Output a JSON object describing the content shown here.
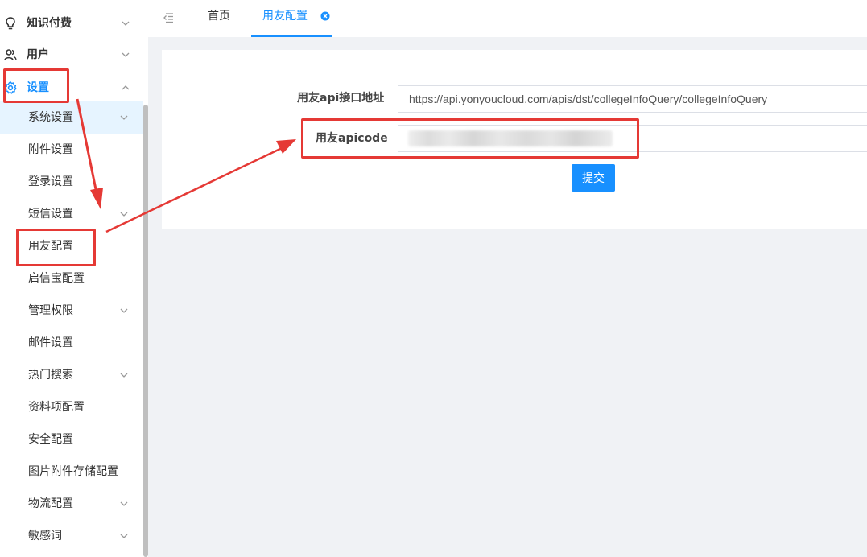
{
  "sidebar": {
    "top_items": [
      {
        "label": "知识付费",
        "icon": "lightbulb-icon"
      },
      {
        "label": "用户",
        "icon": "users-icon"
      },
      {
        "label": "设置",
        "icon": "gear-icon",
        "active": true
      }
    ],
    "sub_items": [
      {
        "label": "系统设置",
        "has_children": true,
        "highlighted": true
      },
      {
        "label": "附件设置",
        "has_children": false
      },
      {
        "label": "登录设置",
        "has_children": false
      },
      {
        "label": "短信设置",
        "has_children": true
      },
      {
        "label": "用友配置",
        "has_children": false
      },
      {
        "label": "启信宝配置",
        "has_children": false
      },
      {
        "label": "管理权限",
        "has_children": true
      },
      {
        "label": "邮件设置",
        "has_children": false
      },
      {
        "label": "热门搜索",
        "has_children": true
      },
      {
        "label": "资料项配置",
        "has_children": false
      },
      {
        "label": "安全配置",
        "has_children": false
      },
      {
        "label": "图片附件存储配置",
        "has_children": false
      },
      {
        "label": "物流配置",
        "has_children": true
      },
      {
        "label": "敏感词",
        "has_children": true
      }
    ]
  },
  "tabs": [
    {
      "label": "首页",
      "active": false
    },
    {
      "label": "用友配置",
      "active": true,
      "closable": true
    }
  ],
  "form": {
    "api_url_label": "用友api接口地址",
    "api_url_value": "https://api.yonyoucloud.com/apis/dst/collegeInfoQuery/collegeInfoQuery",
    "apicode_label": "用友apicode",
    "submit_label": "提交"
  },
  "colors": {
    "accent": "#1890ff",
    "annotation": "#e53935"
  }
}
